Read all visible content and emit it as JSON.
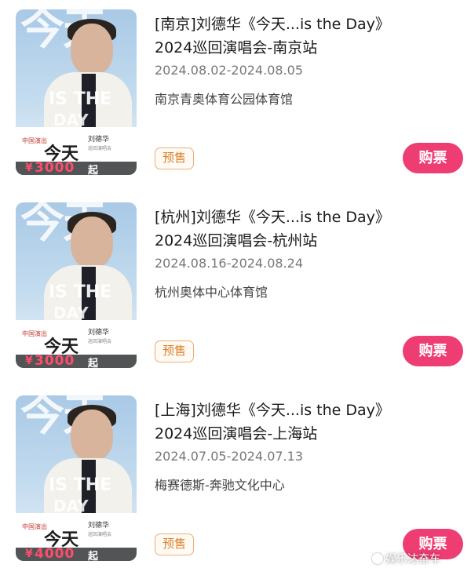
{
  "events": [
    {
      "title_line1": "[南京]刘德华《今天...is the Day》",
      "title_line2": "2024巡回演唱会-南京站",
      "dates": "2024.08.02-2024.08.05",
      "venue": "南京青奥体育公园体育馆",
      "badge": "预售",
      "buy_label": "购票",
      "poster": {
        "price_currency": "¥",
        "price": "3000",
        "price_suffix": "起",
        "poster_title": "今天",
        "poster_watermark": "IS THE",
        "poster_watermark2": "DAY",
        "poster_name": "刘德华",
        "poster_logo": "中国演出",
        "poster_sub": "巡回演唱会"
      }
    },
    {
      "title_line1": "[杭州]刘德华《今天...is the Day》",
      "title_line2": "2024巡回演唱会-杭州站",
      "dates": "2024.08.16-2024.08.24",
      "venue": "杭州奥体中心体育馆",
      "badge": "预售",
      "buy_label": "购票",
      "poster": {
        "price_currency": "¥",
        "price": "3000",
        "price_suffix": "起",
        "poster_title": "今天",
        "poster_watermark": "IS THE",
        "poster_watermark2": "DAY",
        "poster_name": "刘德华",
        "poster_logo": "中国演出",
        "poster_sub": "巡回演唱会"
      }
    },
    {
      "title_line1": "[上海]刘德华《今天...is the Day》",
      "title_line2": "2024巡回演唱会-上海站",
      "dates": "2024.07.05-2024.07.13",
      "venue": "梅赛德斯-奔驰文化中心",
      "badge": "预售",
      "buy_label": "购票",
      "poster": {
        "price_currency": "¥",
        "price": "4000",
        "price_suffix": "起",
        "poster_title": "今天",
        "poster_watermark": "IS THE",
        "poster_watermark2": "DAY",
        "poster_name": "刘德华",
        "poster_logo": "中国演出",
        "poster_sub": "巡回演唱会"
      }
    }
  ],
  "watermark": {
    "text": "娱乐达奋车",
    "icon": "circle-logo-icon"
  },
  "colors": {
    "buy_button": "#ee3d72",
    "badge_border": "#e8b07a",
    "badge_text": "#d9822b",
    "price": "#ff4d6d"
  }
}
